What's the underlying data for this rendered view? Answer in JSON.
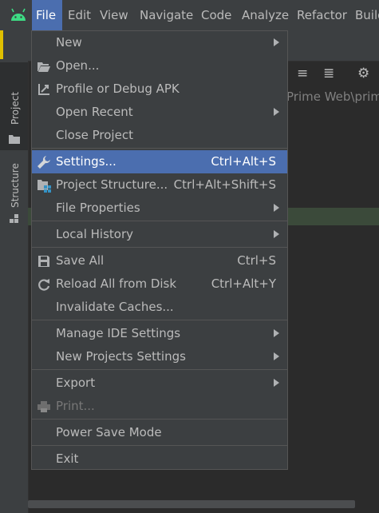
{
  "menubar": {
    "items": [
      {
        "label": "File"
      },
      {
        "label": "Edit"
      },
      {
        "label": "View"
      },
      {
        "label": "Navigate"
      },
      {
        "label": "Code"
      },
      {
        "label": "Analyze"
      },
      {
        "label": "Refactor"
      },
      {
        "label": "Build"
      }
    ]
  },
  "leftbar": {
    "tabs": [
      {
        "label": "Project"
      },
      {
        "label": "Structure"
      }
    ]
  },
  "project": {
    "name": "pr",
    "path": "Prime Web\\prim"
  },
  "file_menu": {
    "items": [
      {
        "label": "New",
        "icon": "none",
        "shortcut": "",
        "submenu": true
      },
      {
        "label": "Open...",
        "icon": "folder-open-icon",
        "shortcut": "",
        "submenu": false
      },
      {
        "label": "Profile or Debug APK",
        "icon": "profile-debug-icon",
        "shortcut": "",
        "submenu": false
      },
      {
        "label": "Open Recent",
        "icon": "none",
        "shortcut": "",
        "submenu": true
      },
      {
        "label": "Close Project",
        "icon": "none",
        "shortcut": "",
        "submenu": false
      },
      {
        "label": "Settings...",
        "icon": "wrench-icon",
        "shortcut": "Ctrl+Alt+S",
        "submenu": false,
        "highlighted": true
      },
      {
        "label": "Project Structure...",
        "icon": "project-structure-icon",
        "shortcut": "Ctrl+Alt+Shift+S",
        "submenu": false
      },
      {
        "label": "File Properties",
        "icon": "none",
        "shortcut": "",
        "submenu": true
      },
      {
        "label": "Local History",
        "icon": "none",
        "shortcut": "",
        "submenu": true
      },
      {
        "label": "Save All",
        "icon": "save-icon",
        "shortcut": "Ctrl+S",
        "submenu": false
      },
      {
        "label": "Reload All from Disk",
        "icon": "reload-icon",
        "shortcut": "Ctrl+Alt+Y",
        "submenu": false
      },
      {
        "label": "Invalidate Caches...",
        "icon": "none",
        "shortcut": "",
        "submenu": false
      },
      {
        "label": "Manage IDE Settings",
        "icon": "none",
        "shortcut": "",
        "submenu": true
      },
      {
        "label": "New Projects Settings",
        "icon": "none",
        "shortcut": "",
        "submenu": true
      },
      {
        "label": "Export",
        "icon": "none",
        "shortcut": "",
        "submenu": true
      },
      {
        "label": "Print...",
        "icon": "print-icon",
        "shortcut": "",
        "submenu": false,
        "disabled": true
      },
      {
        "label": "Power Save Mode",
        "icon": "none",
        "shortcut": "",
        "submenu": false
      },
      {
        "label": "Exit",
        "icon": "none",
        "shortcut": "",
        "submenu": false
      }
    ]
  },
  "colors": {
    "highlight": "#4b6eaf",
    "menu_bg": "#3c3f41",
    "text": "#bbbbbb",
    "android_green": "#3ddc84"
  }
}
